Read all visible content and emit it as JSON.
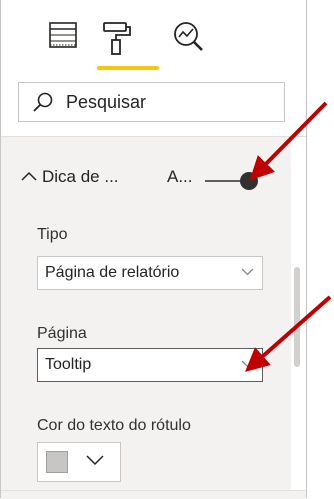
{
  "tabs": [
    {
      "name": "fields",
      "icon": "table-grid-icon"
    },
    {
      "name": "format",
      "icon": "paint-roller-icon",
      "active": true
    },
    {
      "name": "analytics",
      "icon": "magnifier-chart-icon"
    }
  ],
  "colors": {
    "accent": "#f2c811",
    "panel_bg": "#f3f2f1",
    "arrow": "#c00000"
  },
  "search": {
    "placeholder": "Pesquisar",
    "icon": "search-icon"
  },
  "section": {
    "title": "Dica de ...",
    "toggle_label": "A...",
    "toggle_on": true,
    "expanded": true
  },
  "fields": {
    "tipo": {
      "label": "Tipo",
      "value": "Página de relatório"
    },
    "pagina": {
      "label": "Página",
      "value": "Tooltip"
    },
    "cor": {
      "label": "Cor do texto do rótulo",
      "swatch_color": "#c8c6c4"
    }
  }
}
